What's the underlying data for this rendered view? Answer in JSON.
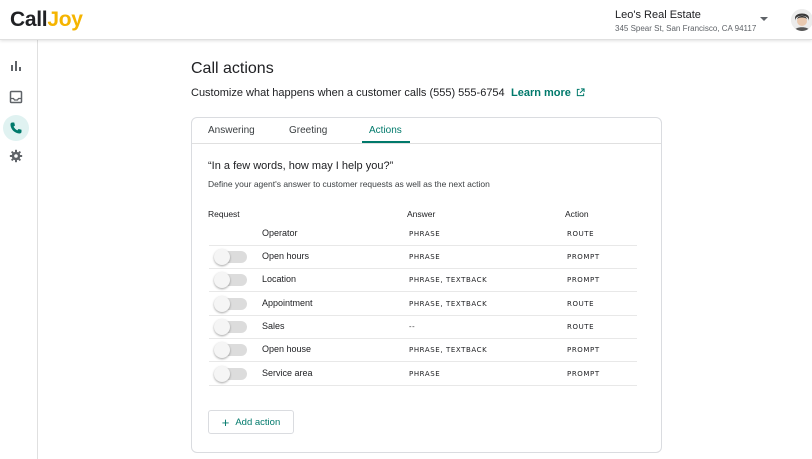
{
  "brand": {
    "part1": "Call",
    "part2": "Joy"
  },
  "business": {
    "name": "Leo's Real Estate",
    "address": "345 Spear St, San Francisco, CA 94117"
  },
  "sidebar": {
    "items": [
      {
        "icon": "bar-chart-icon"
      },
      {
        "icon": "inbox-icon"
      },
      {
        "icon": "phone-icon",
        "active": true
      },
      {
        "icon": "gear-icon"
      }
    ]
  },
  "page": {
    "title": "Call actions",
    "subtitle": "Customize what happens when a customer calls (555) 555-6754",
    "learn_more": "Learn more"
  },
  "tabs": [
    {
      "label": "Answering"
    },
    {
      "label": "Greeting"
    },
    {
      "label": "Actions",
      "active": true
    }
  ],
  "section": {
    "question": "“In a few words, how may I help you?”",
    "description": "Define your agent's answer to customer requests as well as the next action"
  },
  "table": {
    "headers": {
      "request": "Request",
      "answer": "Answer",
      "action": "Action"
    },
    "rows": [
      {
        "request": "Operator",
        "answer": "PHRASE",
        "action": "ROUTE",
        "has_toggle": false
      },
      {
        "request": "Open hours",
        "answer": "PHRASE",
        "action": "PROMPT",
        "has_toggle": true,
        "enabled": false
      },
      {
        "request": "Location",
        "answer": "PHRASE, TEXTBACK",
        "action": "PROMPT",
        "has_toggle": true,
        "enabled": false
      },
      {
        "request": "Appointment",
        "answer": "PHRASE, TEXTBACK",
        "action": "ROUTE",
        "has_toggle": true,
        "enabled": false
      },
      {
        "request": "Sales",
        "answer": "--",
        "action": "ROUTE",
        "has_toggle": true,
        "enabled": false
      },
      {
        "request": "Open house",
        "answer": "PHRASE, TEXTBACK",
        "action": "PROMPT",
        "has_toggle": true,
        "enabled": false
      },
      {
        "request": "Service area",
        "answer": "PHRASE",
        "action": "PROMPT",
        "has_toggle": true,
        "enabled": false
      }
    ]
  },
  "add_action": {
    "label": "Add action"
  },
  "colors": {
    "accent": "#00796b",
    "brand_yellow": "#f5b400",
    "active_nav_bg": "#e0f2f1"
  }
}
